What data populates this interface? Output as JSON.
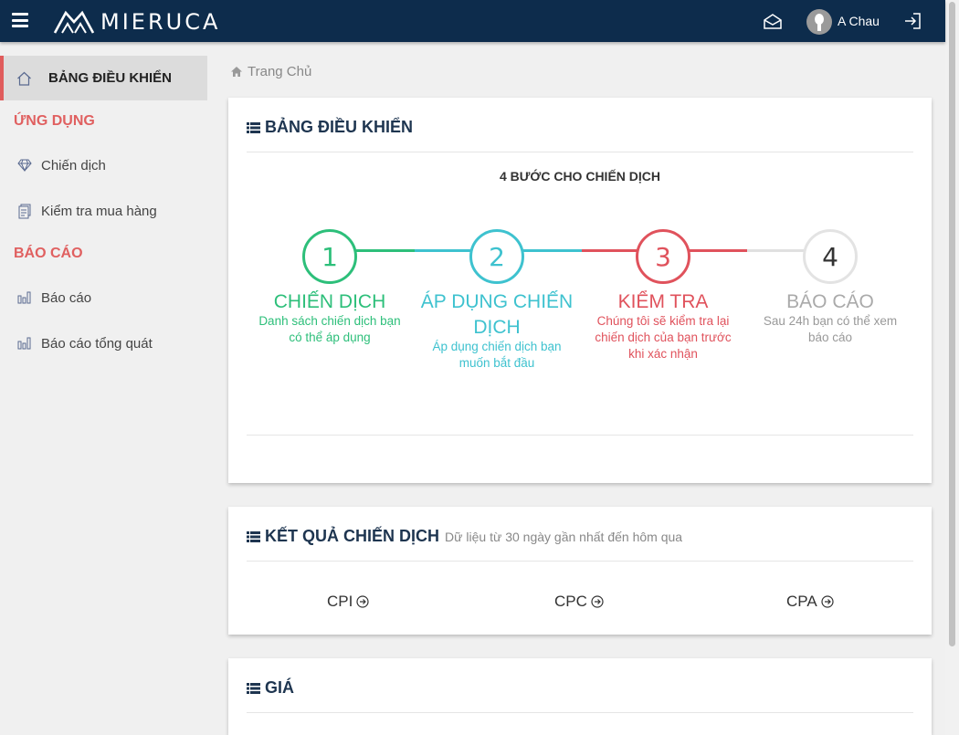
{
  "app": {
    "logo_text": "MIERUCA"
  },
  "header": {
    "username": "A Chau"
  },
  "sidebar": {
    "active_label": "BẢNG ĐIỀU KHIỂN",
    "section_apps": "ỨNG DỤNG",
    "item_campaign": "Chiến dịch",
    "item_purchase_check": "Kiểm tra mua hàng",
    "section_reports": "BÁO CÁO",
    "item_report": "Báo cáo",
    "item_report_overview": "Báo cáo tổng quát"
  },
  "breadcrumb": {
    "home": "Trang Chủ"
  },
  "dashboard": {
    "title": "BẢNG ĐIỀU KHIỂN",
    "steps_title": "4 BƯỚC CHO CHIẾN DỊCH",
    "steps": [
      {
        "number": "1",
        "title": "CHIẾN DỊCH",
        "desc": "Danh sách chiến dịch bạn có thể áp dụng",
        "color": "#2dbf7a"
      },
      {
        "number": "2",
        "title": "ÁP DỤNG CHIẾN DỊCH",
        "desc": "Áp dụng chiến dịch bạn muốn bắt đầu",
        "color": "#3ec2cf"
      },
      {
        "number": "3",
        "title": "KIỂM TRA",
        "desc": "Chúng tôi sẽ kiểm tra lại chiến dịch của bạn trước khi xác nhận",
        "color": "#e0525c"
      },
      {
        "number": "4",
        "title": "BÁO CÁO",
        "desc": "Sau 24h bạn có thể xem báo cáo",
        "color": "#9a9a9a"
      }
    ]
  },
  "results": {
    "title": "KẾT QUẢ CHIẾN DỊCH",
    "subtitle": "Dữ liệu từ 30 ngày gần nhất đến hôm qua",
    "metrics": [
      "CPI",
      "CPC",
      "CPA"
    ]
  },
  "price": {
    "title": "GIÁ"
  }
}
